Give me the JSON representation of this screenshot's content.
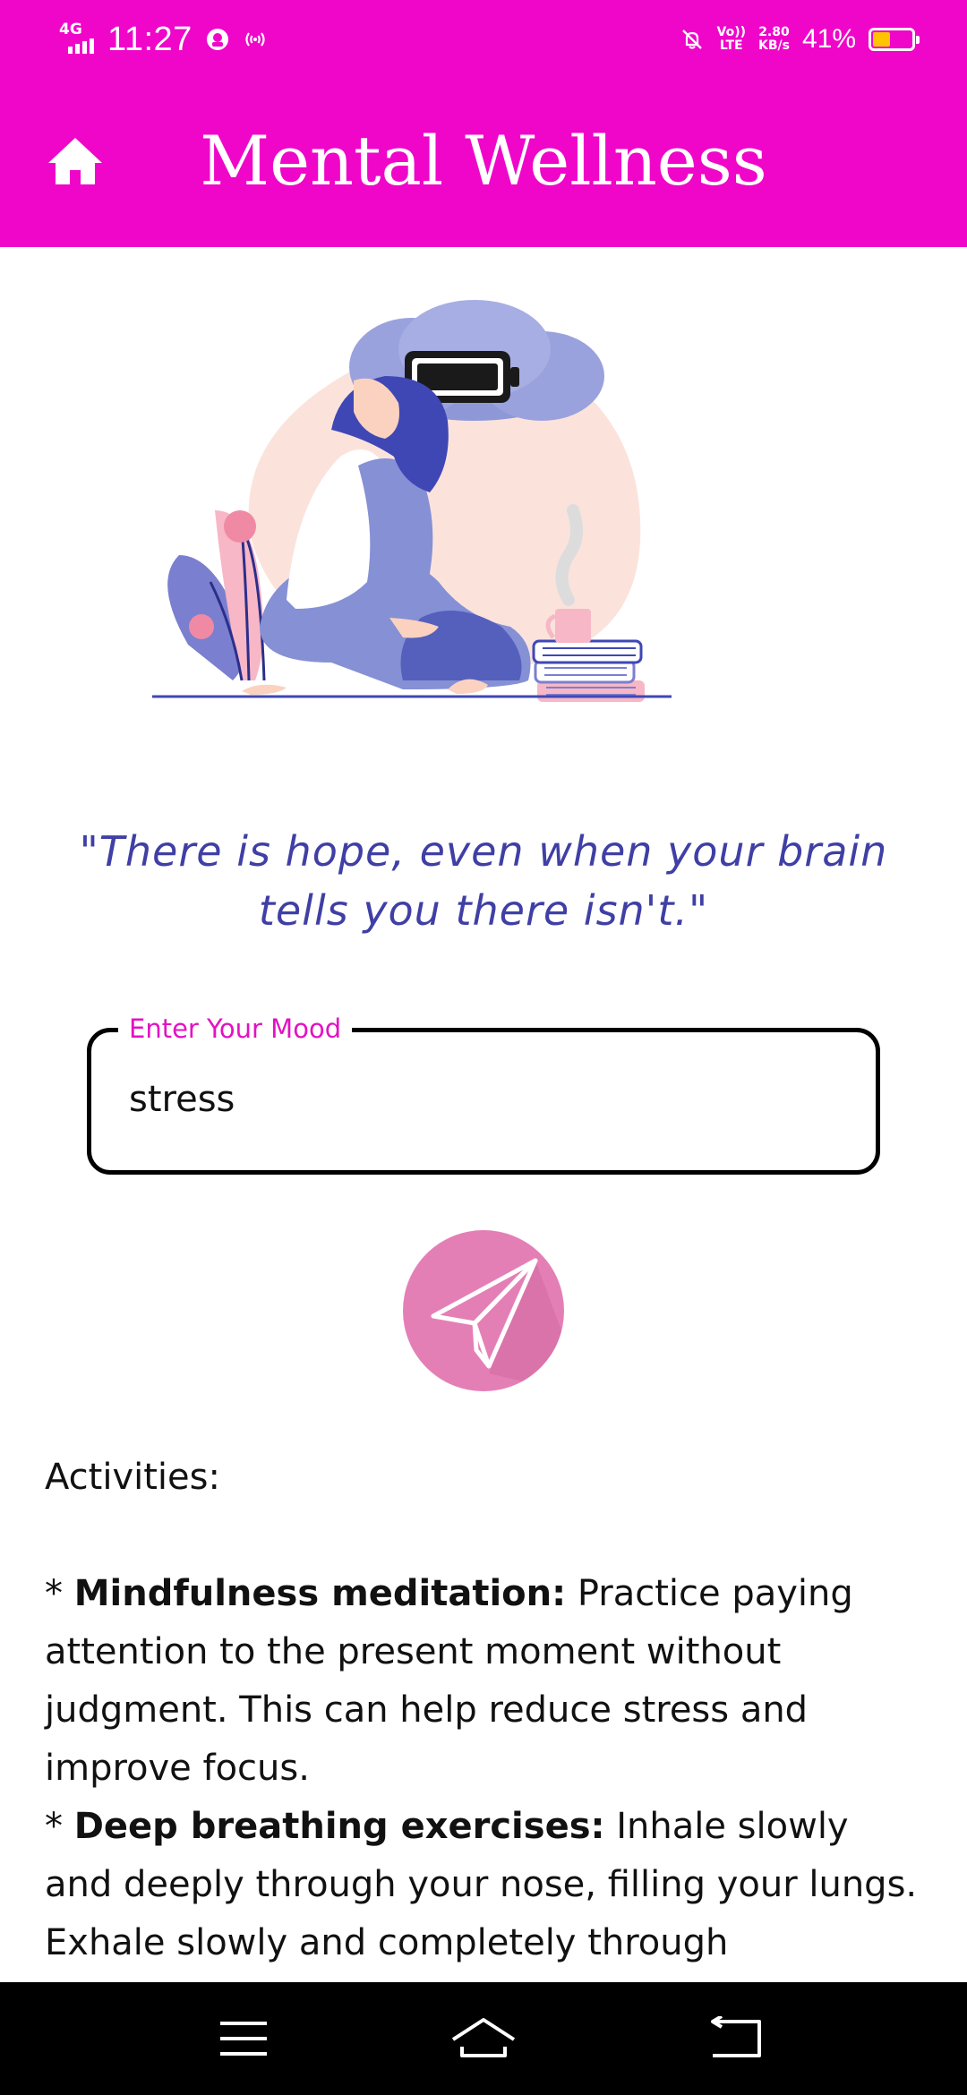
{
  "status_bar": {
    "network": "4G",
    "time": "11:27",
    "volte": "Vo))\nLTE",
    "speed_value": "2.80",
    "speed_unit": "KB/s",
    "battery_percent": "41%",
    "battery_level": 0.41,
    "battery_color": "#ffc400"
  },
  "header": {
    "title": "Mental Wellness",
    "home_icon": "home-icon",
    "background": "#ef06c9"
  },
  "quote": {
    "line1": "\"There is hope, even when your brain",
    "line2": "tells you there isn't.\""
  },
  "mood_input": {
    "label": "Enter Your Mood",
    "value": "stress"
  },
  "send_button": {
    "icon": "paper-plane-icon",
    "color": "#e47fb6"
  },
  "activities": {
    "heading": "Activities:",
    "items": [
      {
        "bullet": "* ",
        "title": "Mindfulness meditation:",
        "text": " Practice paying attention to the present moment without judgment. This can help reduce stress and improve focus."
      },
      {
        "bullet": "* ",
        "title": "Deep breathing exercises:",
        "text": " Inhale slowly and deeply through your nose, filling your lungs. Exhale slowly and completely through"
      }
    ]
  },
  "nav_bar": {
    "menu_icon": "menu-icon",
    "home_icon": "home-outline-icon",
    "back_icon": "back-icon"
  }
}
